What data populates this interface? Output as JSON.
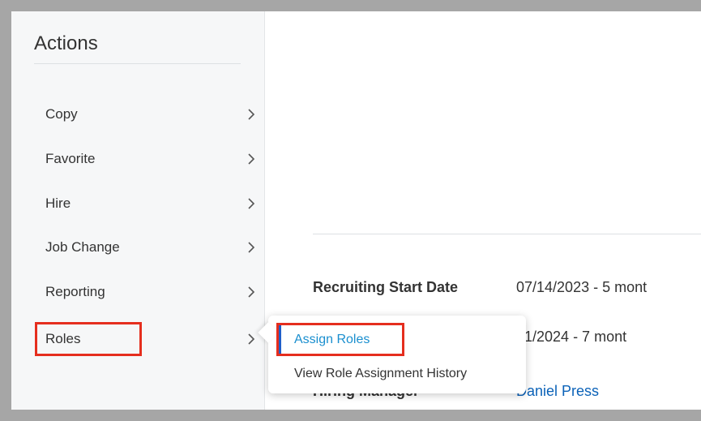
{
  "sidebar": {
    "title": "Actions",
    "items": [
      {
        "label": "Copy"
      },
      {
        "label": "Favorite"
      },
      {
        "label": "Hire"
      },
      {
        "label": "Job Change"
      },
      {
        "label": "Reporting"
      },
      {
        "label": "Roles"
      }
    ]
  },
  "main": {
    "fields": [
      {
        "label": "Recruiting Start Date",
        "value": "07/14/2023 - 5 mont"
      },
      {
        "label": "",
        "value": "01/2024 - 7 mont"
      },
      {
        "label": "Hiring Manager",
        "value": "Daniel Press"
      }
    ]
  },
  "submenu": {
    "items": [
      {
        "label": "Assign Roles"
      },
      {
        "label": "View Role Assignment History"
      }
    ]
  },
  "colors": {
    "highlight": "#e52e1e",
    "link": "#0b62b8",
    "active_text": "#1a8fcf",
    "accent_bar": "#1f5ec9"
  },
  "icons": {
    "chevron": "chevron-right-icon"
  }
}
